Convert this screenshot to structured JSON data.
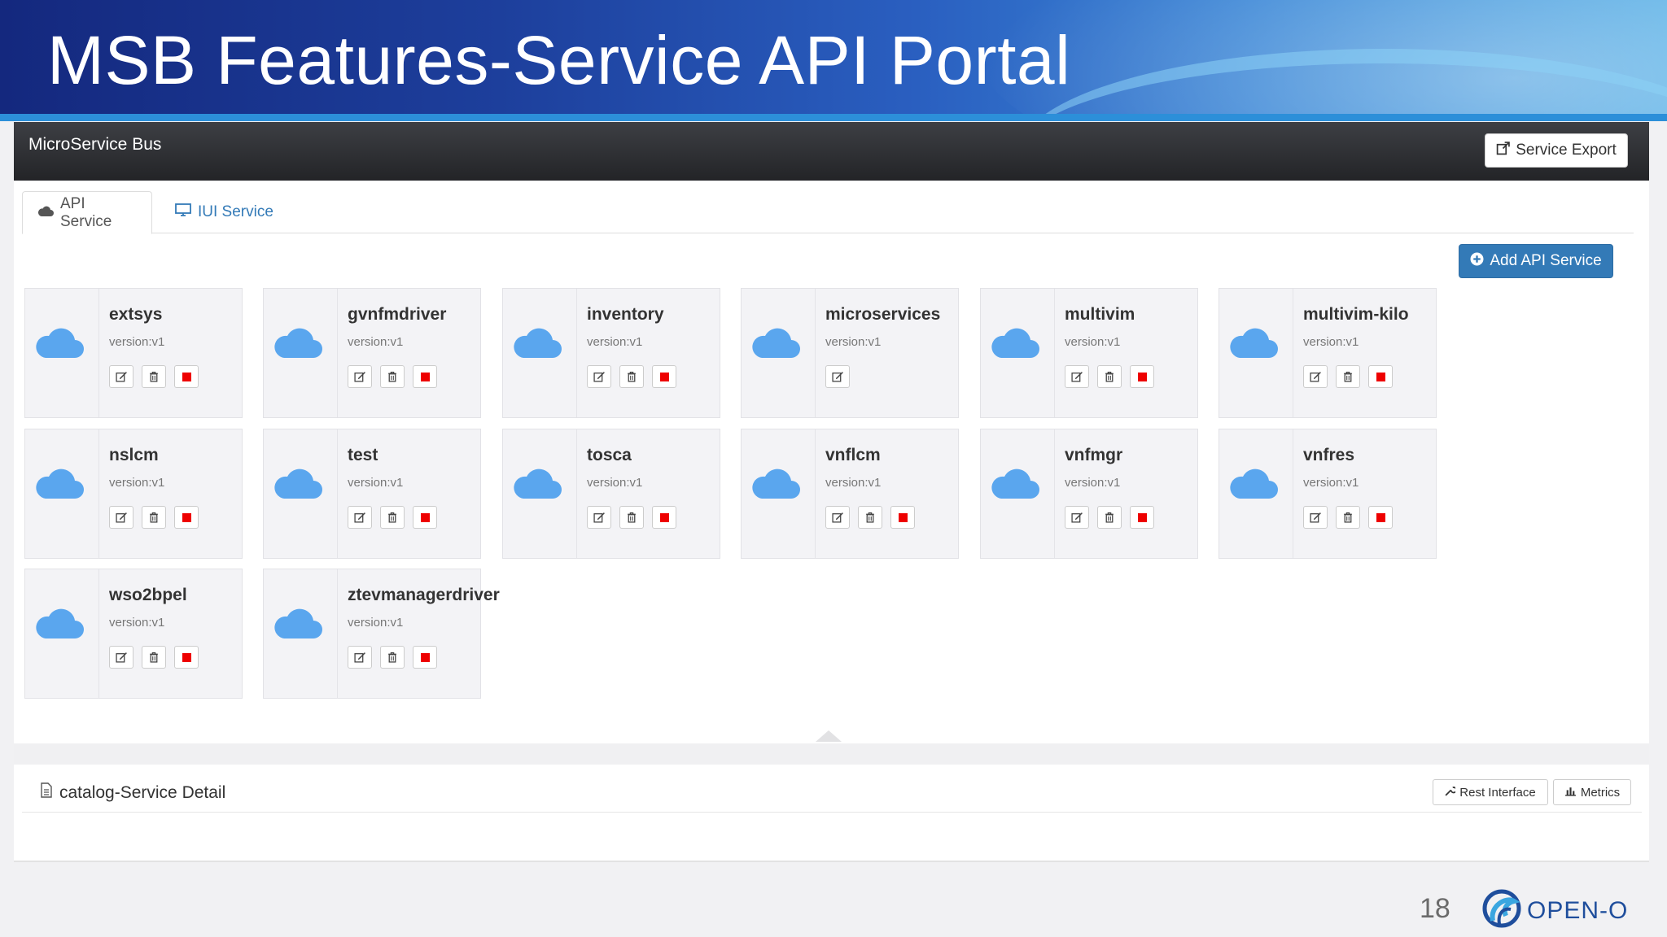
{
  "slide": {
    "title": "MSB Features-Service API Portal",
    "page_number": "18",
    "logo_text": "OPEN-O"
  },
  "navbar": {
    "brand": "MicroService Bus",
    "export_label": "Service Export"
  },
  "tabs": [
    {
      "label": "API Service",
      "icon": "cloud-icon",
      "active": true
    },
    {
      "label": "IUI Service",
      "icon": "monitor-icon",
      "active": false
    }
  ],
  "add_button_label": "Add API Service",
  "services": [
    {
      "name": "extsys",
      "version": "version:v1",
      "actions": [
        "edit",
        "delete",
        "stop"
      ]
    },
    {
      "name": "gvnfmdriver",
      "version": "version:v1",
      "actions": [
        "edit",
        "delete",
        "stop"
      ]
    },
    {
      "name": "inventory",
      "version": "version:v1",
      "actions": [
        "edit",
        "delete",
        "stop"
      ]
    },
    {
      "name": "microservices",
      "version": "version:v1",
      "actions": [
        "edit"
      ]
    },
    {
      "name": "multivim",
      "version": "version:v1",
      "actions": [
        "edit",
        "delete",
        "stop"
      ]
    },
    {
      "name": "multivim-kilo",
      "version": "version:v1",
      "actions": [
        "edit",
        "delete",
        "stop"
      ]
    },
    {
      "name": "nslcm",
      "version": "version:v1",
      "actions": [
        "edit",
        "delete",
        "stop"
      ]
    },
    {
      "name": "test",
      "version": "version:v1",
      "actions": [
        "edit",
        "delete",
        "stop"
      ]
    },
    {
      "name": "tosca",
      "version": "version:v1",
      "actions": [
        "edit",
        "delete",
        "stop"
      ]
    },
    {
      "name": "vnflcm",
      "version": "version:v1",
      "actions": [
        "edit",
        "delete",
        "stop"
      ]
    },
    {
      "name": "vnfmgr",
      "version": "version:v1",
      "actions": [
        "edit",
        "delete",
        "stop"
      ]
    },
    {
      "name": "vnfres",
      "version": "version:v1",
      "actions": [
        "edit",
        "delete",
        "stop"
      ]
    },
    {
      "name": "wso2bpel",
      "version": "version:v1",
      "actions": [
        "edit",
        "delete",
        "stop"
      ]
    },
    {
      "name": "ztevmanagerdriver",
      "version": "version:v1",
      "actions": [
        "edit",
        "delete",
        "stop"
      ]
    }
  ],
  "detail": {
    "title": "catalog-Service Detail",
    "rest_label": "Rest Interface",
    "metrics_label": "Metrics"
  },
  "colors": {
    "accent": "#337ab7",
    "cloud": "#5aa6ee",
    "stop": "#ee0000"
  }
}
